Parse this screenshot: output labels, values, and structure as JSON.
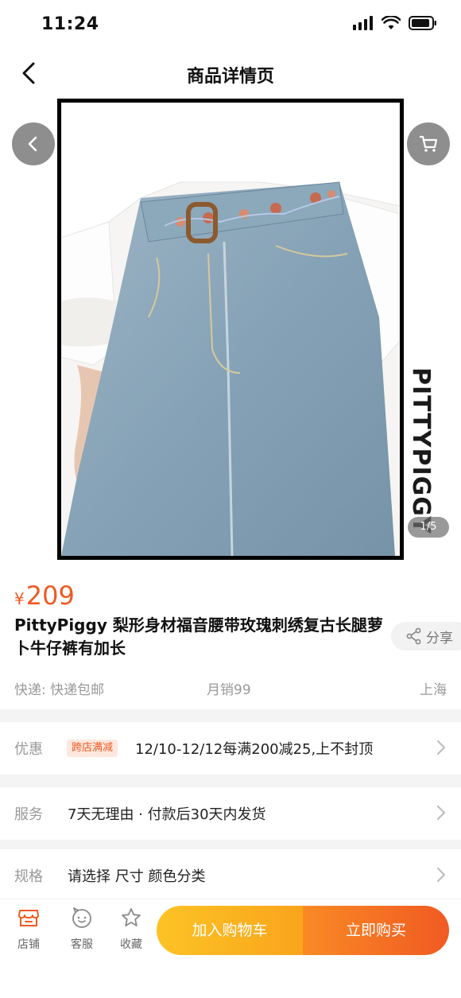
{
  "status": {
    "time": "11:24"
  },
  "nav": {
    "title": "商品详情页"
  },
  "gallery": {
    "watermark": "PITTYPIGGY",
    "indicator": "1/5"
  },
  "product": {
    "currency": "¥",
    "price": "209",
    "title": "PittyPiggy 梨形身材福音腰带玫瑰刺绣复古长腿萝卜牛仔裤有加长",
    "share_label": "分享",
    "shipping": "快递: 快递包邮",
    "monthly_sales": "月销99",
    "location": "上海"
  },
  "rows": {
    "promo": {
      "label": "优惠",
      "tag": "跨店满减",
      "text": "12/10-12/12每满200减25,上不封顶"
    },
    "service": {
      "label": "服务",
      "text": "7天无理由 · 付款后30天内发货"
    },
    "spec": {
      "label": "规格",
      "text": "请选择 尺寸 颜色分类"
    }
  },
  "bottom": {
    "store": "店铺",
    "service": "客服",
    "favorite": "收藏",
    "add_to_cart": "加入购物车",
    "buy_now": "立即购买"
  },
  "colors": {
    "accent": "#f05a22",
    "cart_button": "#fcb922",
    "buy_button": "#f26b22"
  }
}
